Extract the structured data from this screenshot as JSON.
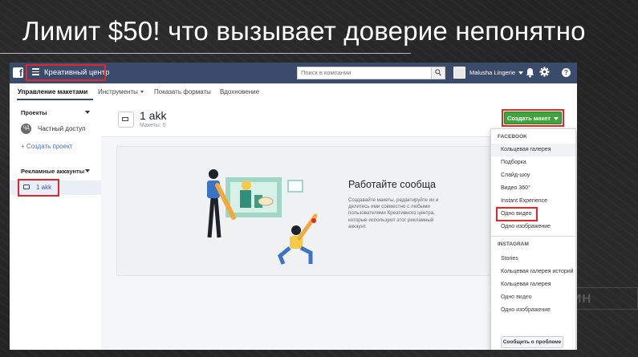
{
  "slide": {
    "title": "Лимит $50! что вызывает доверие непонятно"
  },
  "topbar": {
    "logo": "f",
    "app_title": "Креативный центр",
    "search_placeholder": "Поиск в компании",
    "account_name": "Malusha Lingerie",
    "help": "?"
  },
  "nav": {
    "tabs": [
      {
        "label": "Управление макетами",
        "active": true
      },
      {
        "label": "Инструменты",
        "dropdown": true
      },
      {
        "label": "Показать форматы"
      },
      {
        "label": "Вдохновение"
      }
    ]
  },
  "sidebar": {
    "projects_label": "Проекты",
    "private_label": "Частный доступ",
    "private_initials": "ЧД",
    "create_project": "+ Создать проект",
    "ad_accounts_label": "Рекламные аккаунты",
    "account_item": "1 akk"
  },
  "header": {
    "account_name": "1 akk",
    "mockups_count": "Макеты: 0",
    "create_button": "Создать макет"
  },
  "empty_state": {
    "title": "Работайте сообща",
    "description": "Создавайте макеты, редактируйте их и делитесь ими совместно с любыми пользователями Креативного центра, которые используют этот рекламный аккаунт."
  },
  "dropdown": {
    "facebook_header": "FACEBOOK",
    "facebook_items": [
      "Кольцевая галерея",
      "Подборка",
      "Слайд-шоу",
      "Видео 360°",
      "Instant Experience",
      "Одно видео",
      "Одно изображение"
    ],
    "instagram_header": "INSTAGRAM",
    "instagram_items": [
      "Stories",
      "Кольцевая галерея историй",
      "Кольцевая галерея",
      "Одно видео",
      "Одно изображение"
    ]
  },
  "footer": {
    "report_button": "Сообщить о проблеме"
  },
  "watermark": {
    "text": "ПАРТНЕРКИН"
  },
  "colors": {
    "topbar": "#3b4b6c",
    "create_button": "#42a33c",
    "highlight_box": "#e0282c",
    "slide_background": "#242424"
  }
}
